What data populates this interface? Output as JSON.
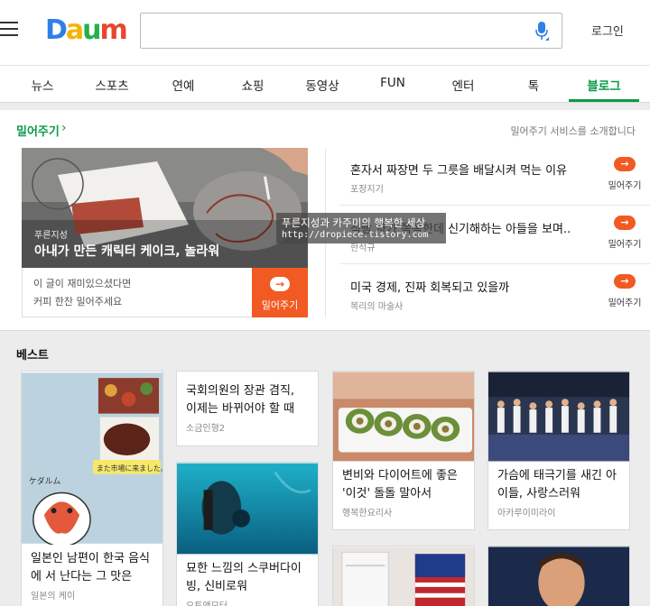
{
  "header": {
    "logo": [
      "D",
      "a",
      "u",
      "m"
    ],
    "login": "로그인"
  },
  "nav": {
    "items": [
      "뉴스",
      "스포츠",
      "연예",
      "쇼핑",
      "동영상",
      "FUN",
      "엔터",
      "톡",
      "블로그"
    ],
    "active": "블로그"
  },
  "push": {
    "title": "밀어주기",
    "intro": "밀어주기 서비스를 소개합니다",
    "feature": {
      "source": "푸른지성",
      "title": "아내가 만든 캐릭터 케이크, 놀라워",
      "note1": "이 글이 재미있으셨다면",
      "note2": "커피 한잔 밀어주세요",
      "button": "밀어주기"
    },
    "items": [
      {
        "title": "혼자서 짜장면 두 그릇을 배달시켜 먹는 이유",
        "source": "포장지기",
        "button": "밀어주기"
      },
      {
        "title": "식빵 자가 쪽쪽한데 신기해하는 아들을 보며..",
        "source": "한석규",
        "button": "밀어주기"
      },
      {
        "title": "미국 경제, 진짜 회복되고 있을까",
        "source": "복리의 마술사",
        "button": "밀어주기"
      }
    ],
    "watermark": {
      "line1": "푸른지성과 카주미의 행복한 세상",
      "line2": "http://dropiece.tistory.com"
    }
  },
  "best": {
    "title": "베스트",
    "cards": [
      {
        "title": "일본인 남편이 한국 음식에 서 난다는 그 맛은",
        "source": "일본의 케이",
        "img_caption": "また市場に来ました。",
        "img_label": "ケダルム"
      },
      {
        "title": "국회의원의 장관 겸직, 이제는 바뀌어야 할 때",
        "source": "소금인형2"
      },
      {
        "title": "묘한 느낌의 스쿠버다이빙, 신비로워",
        "source": "오토앤모터"
      },
      {
        "title": "변비와 다이어트에 좋은 '이것' 돌돌 말아서",
        "source": "행복한요리사"
      },
      {
        "title": "가슴에 태극기를 새긴 아이들, 사랑스러워",
        "source": "아카루이미라이"
      }
    ]
  },
  "colors": {
    "accent_green": "#0a9b49",
    "push_orange": "#f15a22"
  }
}
